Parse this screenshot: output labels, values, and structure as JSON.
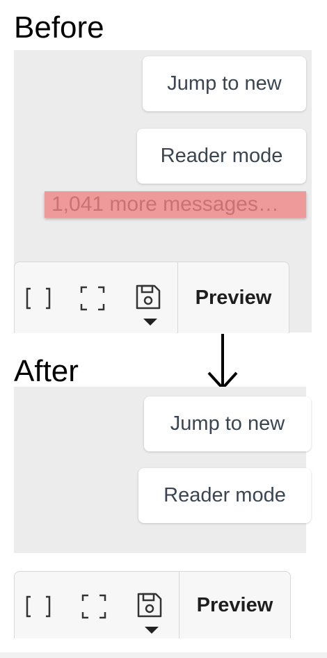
{
  "before": {
    "heading": "Before",
    "jump_label": "Jump to new",
    "reader_label": "Reader mode",
    "more_messages": "1,041 more messages…",
    "preview_label": "Preview"
  },
  "after": {
    "heading": "After",
    "jump_label": "Jump to new",
    "reader_label": "Reader mode",
    "preview_label": "Preview"
  },
  "icons": {
    "toolbar": [
      "brackets-icon",
      "fullscreen-icon",
      "save-icon",
      "dropdown-caret-icon"
    ],
    "transition": "down-arrow-icon"
  },
  "colors": {
    "panel_bg": "#ececec",
    "pill_text": "#3a4553",
    "highlight": "#ef9a9a",
    "highlight_text": "#c97272"
  }
}
